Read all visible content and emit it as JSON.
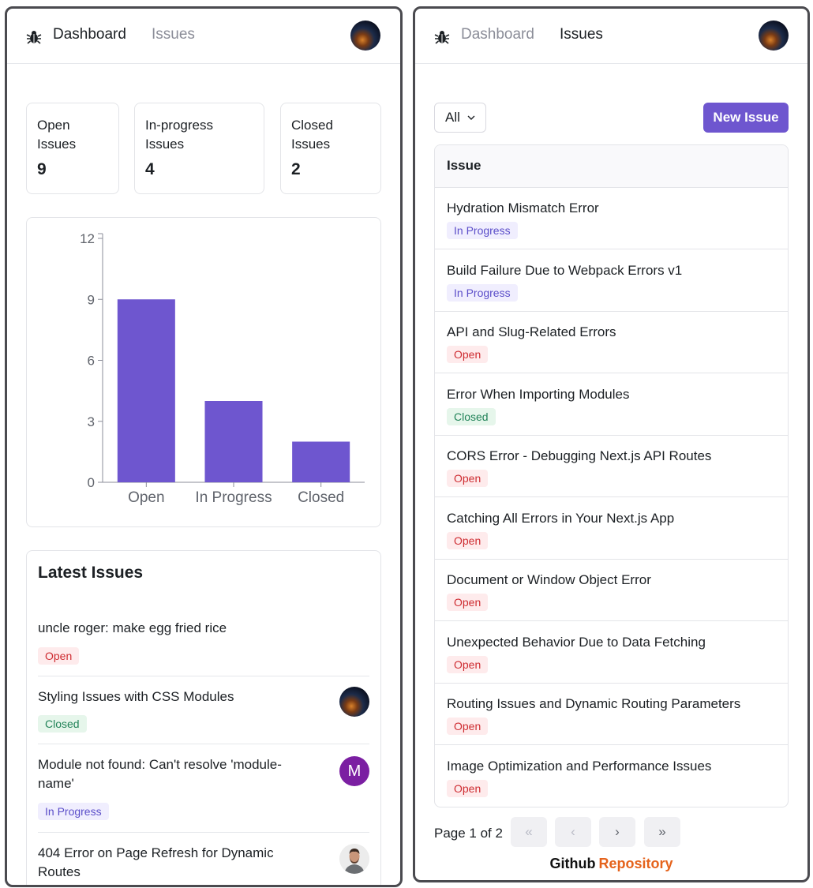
{
  "nav": {
    "dashboard_label": "Dashboard",
    "issues_label": "Issues"
  },
  "summary": [
    {
      "label_line1": "Open",
      "label_line2": "Issues",
      "count": "9"
    },
    {
      "label_line1": "In-progress",
      "label_line2": "Issues",
      "count": "4"
    },
    {
      "label_line1": "Closed",
      "label_line2": "Issues",
      "count": "2"
    }
  ],
  "chart_data": {
    "type": "bar",
    "categories": [
      "Open",
      "In Progress",
      "Closed"
    ],
    "values": [
      9,
      4,
      2
    ],
    "ylim": [
      0,
      12
    ],
    "yticks": [
      0,
      3,
      6,
      9,
      12
    ],
    "grid": false,
    "bar_color": "#6e56cf",
    "title": "",
    "xlabel": "",
    "ylabel": ""
  },
  "latest": {
    "title": "Latest Issues",
    "items": [
      {
        "title": "uncle roger: make egg fried rice",
        "status": "Open"
      },
      {
        "title": "Styling Issues with CSS Modules",
        "status": "Closed",
        "avatar": "dark-avatar"
      },
      {
        "title": "Module not found: Can't resolve 'module-name'",
        "status": "In Progress",
        "avatar_letter": "M"
      },
      {
        "title": "404 Error on Page Refresh for Dynamic Routes",
        "avatar": "photo-avatar"
      }
    ]
  },
  "issues_page": {
    "filter_value": "All",
    "new_issue_label": "New Issue",
    "column_header": "Issue",
    "rows": [
      {
        "title": "Hydration Mismatch Error",
        "status": "In Progress"
      },
      {
        "title": "Build Failure Due to Webpack Errors v1",
        "status": "In Progress"
      },
      {
        "title": "API and Slug-Related Errors",
        "status": "Open"
      },
      {
        "title": "Error When Importing Modules",
        "status": "Closed"
      },
      {
        "title": "CORS Error - Debugging Next.js API Routes",
        "status": "Open"
      },
      {
        "title": "Catching All Errors in Your Next.js App",
        "status": "Open"
      },
      {
        "title": "Document or Window Object Error",
        "status": "Open"
      },
      {
        "title": "Unexpected Behavior Due to Data Fetching",
        "status": "Open"
      },
      {
        "title": "Routing Issues and Dynamic Routing Parameters",
        "status": "Open"
      },
      {
        "title": "Image Optimization and Performance Issues",
        "status": "Open"
      }
    ],
    "pagination": {
      "label": "Page 1 of 2",
      "first": "«",
      "prev": "‹",
      "next": "›",
      "last": "»"
    },
    "footer": {
      "part1": "Github",
      "part2": "Repository"
    }
  },
  "colors": {
    "accent": "#6e56cf",
    "open_badge": "#ce2c31",
    "progress_badge": "#5b4ec9",
    "closed_badge": "#218358",
    "footer_accent": "#e5631c"
  }
}
